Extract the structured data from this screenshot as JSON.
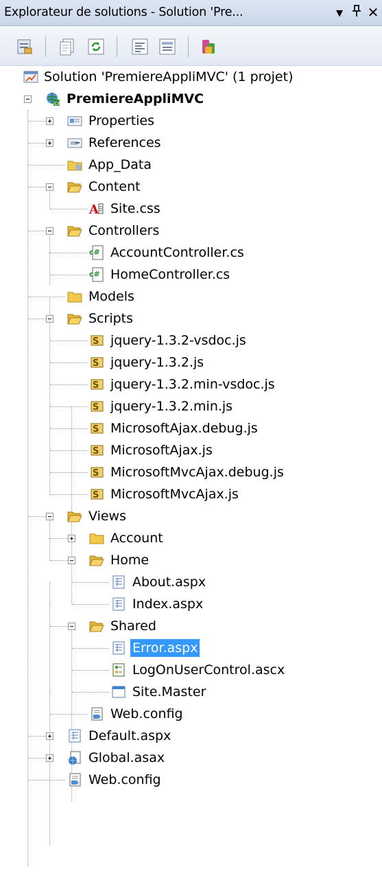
{
  "window": {
    "title": "Explorateur de solutions - Solution 'Pre...",
    "buttons": {
      "dropdown": "▾",
      "pin": "ᚐ",
      "close": "✕"
    }
  },
  "toolbar": {
    "icons": [
      "properties-icon",
      "show-all-files-icon",
      "refresh-icon",
      "view-code-icon",
      "view-designer-icon",
      "class-diagram-icon"
    ]
  },
  "colors": {
    "selection": "#3399ff",
    "folder": "#f3c94b",
    "titlebar": "#d3ddee"
  },
  "tree": {
    "solution": "Solution 'PremiereAppliMVC' (1 projet)",
    "project": "PremiereAppliMVC",
    "properties": "Properties",
    "references": "References",
    "app_data": "App_Data",
    "content": "Content",
    "site_css": "Site.css",
    "controllers": "Controllers",
    "account_controller": "AccountController.cs",
    "home_controller": "HomeController.cs",
    "models": "Models",
    "scripts": "Scripts",
    "script_files": [
      "jquery-1.3.2-vsdoc.js",
      "jquery-1.3.2.js",
      "jquery-1.3.2.min-vsdoc.js",
      "jquery-1.3.2.min.js",
      "MicrosoftAjax.debug.js",
      "MicrosoftAjax.js",
      "MicrosoftMvcAjax.debug.js",
      "MicrosoftMvcAjax.js"
    ],
    "views": "Views",
    "account": "Account",
    "home": "Home",
    "about": "About.aspx",
    "index": "Index.aspx",
    "shared": "Shared",
    "error": "Error.aspx",
    "logon_control": "LogOnUserControl.ascx",
    "site_master": "Site.Master",
    "views_web_config": "Web.config",
    "default_aspx": "Default.aspx",
    "global_asax": "Global.asax",
    "web_config": "Web.config"
  }
}
